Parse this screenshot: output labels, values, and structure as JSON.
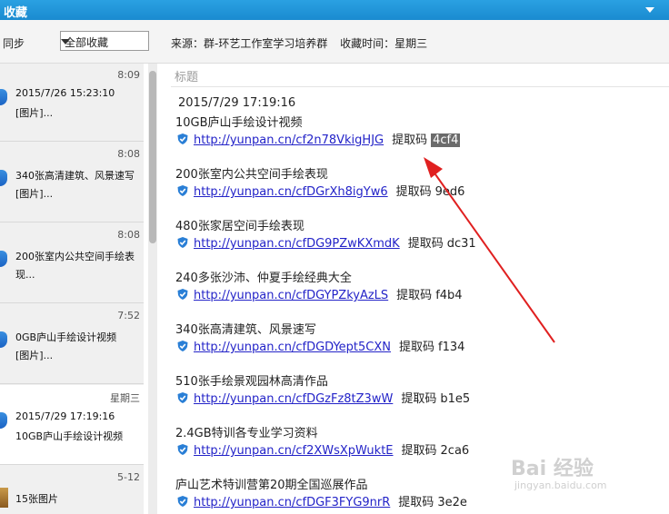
{
  "window": {
    "title": "收藏"
  },
  "toolbar": {
    "sync_label": "同步",
    "filter_selected": "全部收藏",
    "source": "来源：群-环艺工作室学习培养群",
    "collect_time": "收藏时间：星期三"
  },
  "sidebar": {
    "items": [
      {
        "time": "8:09",
        "line1": "2015/7/26 15:23:10",
        "line2": "[图片]..."
      },
      {
        "time": "8:08",
        "line1": "340张高清建筑、风景速写",
        "line2": "[图片]..."
      },
      {
        "time": "8:08",
        "line1": "200张室内公共空间手绘表",
        "line2": "现..."
      },
      {
        "time": "7:52",
        "line1": "0GB庐山手绘设计视频",
        "line2": "[图片]..."
      },
      {
        "time": "星期三",
        "line1": "2015/7/29 17:19:16",
        "line2": "10GB庐山手绘设计视频"
      },
      {
        "time": "5-12",
        "line1": "15张图片",
        "line2": ""
      }
    ]
  },
  "content": {
    "heading": "标题",
    "date": "2015/7/29 17:19:16",
    "code_label": "提取码",
    "entries": [
      {
        "title": "10GB庐山手绘设计视频",
        "url": "http://yunpan.cn/cf2n78VkigHJG",
        "code": "4cf4"
      },
      {
        "title": "200张室内公共空间手绘表现",
        "url": "http://yunpan.cn/cfDGrXh8igYw6",
        "code": "9ed6"
      },
      {
        "title": "480张家居空间手绘表现",
        "url": "http://yunpan.cn/cfDG9PZwKXmdK",
        "code": "dc31"
      },
      {
        "title": "240多张沙沛、仲夏手绘经典大全",
        "url": "http://yunpan.cn/cfDGYPZkyAzLS",
        "code": "f4b4"
      },
      {
        "title": "340张高清建筑、风景速写",
        "url": "http://yunpan.cn/cfDGDYept5CXN",
        "code": "f134"
      },
      {
        "title": "510张手绘景观园林高清作品",
        "url": "http://yunpan.cn/cfDGzFz8tZ3wW",
        "code": "b1e5"
      },
      {
        "title": "2.4GB特训各专业学习资料",
        "url": "http://yunpan.cn/cf2XWsXpWuktE",
        "code": "2ca6"
      },
      {
        "title": "庐山艺术特训营第20期全国巡展作品",
        "url": "http://yunpan.cn/cfDGF3FYG9nrR",
        "code": "3e2e"
      }
    ]
  },
  "watermark": {
    "brand": "Bai 经验",
    "site": "jingyan.baidu.com"
  },
  "colors": {
    "titlebar": "#1a8bd0",
    "link": "#2323c8",
    "annotation_arrow": "#e02020"
  }
}
